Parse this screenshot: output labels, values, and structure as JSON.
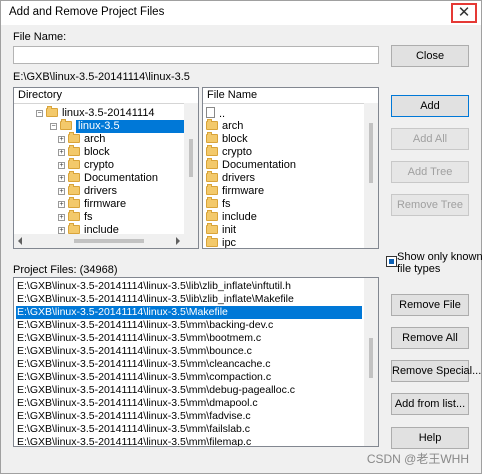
{
  "window": {
    "title": "Add and Remove Project Files",
    "close_glyph": "✕"
  },
  "file_name": {
    "label": "File Name:",
    "value": ""
  },
  "current_path": "E:\\GXB\\linux-3.5-20141114\\linux-3.5",
  "directory_panel": {
    "header": "Directory",
    "root": "linux-3.5-20141114",
    "selected": "linux-3.5",
    "children": [
      "arch",
      "block",
      "crypto",
      "Documentation",
      "drivers",
      "firmware",
      "fs",
      "include",
      "init"
    ]
  },
  "file_panel": {
    "header": "File Name",
    "items": [
      "..",
      "arch",
      "block",
      "crypto",
      "Documentation",
      "drivers",
      "firmware",
      "fs",
      "include",
      "init",
      "ipc"
    ]
  },
  "buttons": {
    "close": "Close",
    "add": "Add",
    "add_all": "Add All",
    "add_tree": "Add Tree",
    "remove_tree": "Remove Tree",
    "remove_file": "Remove File",
    "remove_all": "Remove All",
    "remove_special": "Remove Special...",
    "add_from_list": "Add from list...",
    "help": "Help"
  },
  "show_known_types": {
    "label_line1": "Show only known",
    "label_line2": "file types",
    "checked": true
  },
  "project_files": {
    "label": "Project Files: (34968)",
    "selected_index": 2,
    "items": [
      "E:\\GXB\\linux-3.5-20141114\\linux-3.5\\lib\\zlib_inflate\\inftutil.h",
      "E:\\GXB\\linux-3.5-20141114\\linux-3.5\\lib\\zlib_inflate\\Makefile",
      "E:\\GXB\\linux-3.5-20141114\\linux-3.5\\Makefile",
      "E:\\GXB\\linux-3.5-20141114\\linux-3.5\\mm\\backing-dev.c",
      "E:\\GXB\\linux-3.5-20141114\\linux-3.5\\mm\\bootmem.c",
      "E:\\GXB\\linux-3.5-20141114\\linux-3.5\\mm\\bounce.c",
      "E:\\GXB\\linux-3.5-20141114\\linux-3.5\\mm\\cleancache.c",
      "E:\\GXB\\linux-3.5-20141114\\linux-3.5\\mm\\compaction.c",
      "E:\\GXB\\linux-3.5-20141114\\linux-3.5\\mm\\debug-pagealloc.c",
      "E:\\GXB\\linux-3.5-20141114\\linux-3.5\\mm\\dmapool.c",
      "E:\\GXB\\linux-3.5-20141114\\linux-3.5\\mm\\fadvise.c",
      "E:\\GXB\\linux-3.5-20141114\\linux-3.5\\mm\\failslab.c",
      "E:\\GXB\\linux-3.5-20141114\\linux-3.5\\mm\\filemap.c"
    ]
  },
  "watermark": "CSDN @老王WHH",
  "colors": {
    "selection": "#0078d7",
    "close_highlight": "#e53935"
  }
}
